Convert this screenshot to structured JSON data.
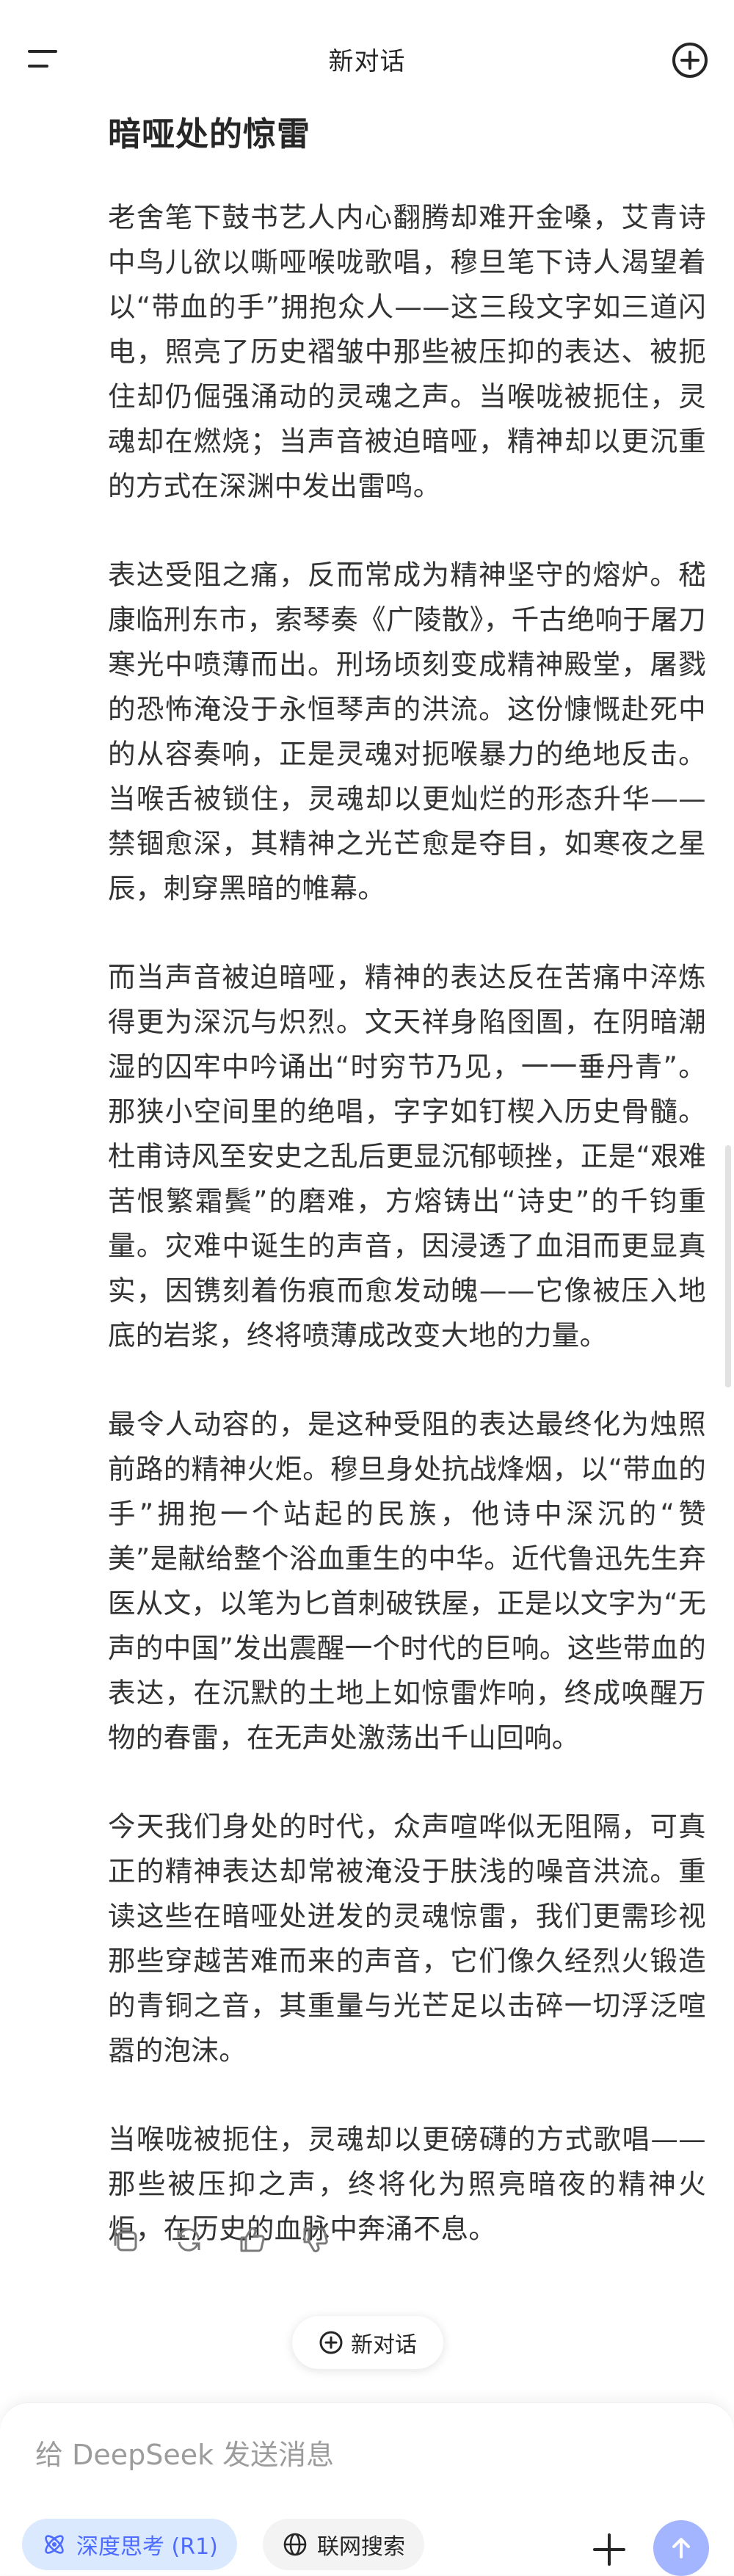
{
  "header": {
    "title": "新对话",
    "menu_icon": "menu-icon",
    "new_chat_icon": "new-chat-plus-icon"
  },
  "article": {
    "title": "暗哑处的惊雷",
    "paragraphs": [
      "老舍笔下鼓书艺人内心翻腾却难开金嗓，艾青诗中鸟儿欲以嘶哑喉咙歌唱，穆旦笔下诗人渴望着以“带血的手”拥抱众人——这三段文字如三道闪电，照亮了历史褶皱中那些被压抑的表达、被扼住却仍倔强涌动的灵魂之声。当喉咙被扼住，灵魂却在燃烧；当声音被迫暗哑，精神却以更沉重的方式在深渊中发出雷鸣。",
      "表达受阻之痛，反而常成为精神坚守的熔炉。嵇康临刑东市，索琴奏《广陵散》，千古绝响于屠刀寒光中喷薄而出。刑场顷刻变成精神殿堂，屠戮的恐怖淹没于永恒琴声的洪流。这份慷慨赴死中的从容奏响，正是灵魂对扼喉暴力的绝地反击。当喉舌被锁住，灵魂却以更灿烂的形态升华——禁锢愈深，其精神之光芒愈是夺目，如寒夜之星辰，刺穿黑暗的帷幕。",
      "而当声音被迫暗哑，精神的表达反在苦痛中淬炼得更为深沉与炽烈。文天祥身陷囹圄，在阴暗潮湿的囚牢中吟诵出“时穷节乃见，一一垂丹青”。那狭小空间里的绝唱，字字如钉楔入历史骨髓。杜甫诗风至安史之乱后更显沉郁顿挫，正是“艰难苦恨繁霜鬓”的磨难，方熔铸出“诗史”的千钧重量。灾难中诞生的声音，因浸透了血泪而更显真实，因镌刻着伤痕而愈发动魄——它像被压入地底的岩浆，终将喷薄成改变大地的力量。",
      "最令人动容的，是这种受阻的表达最终化为烛照前路的精神火炬。穆旦身处抗战烽烟，以“带血的手”拥抱一个站起的民族，他诗中深沉的“赞美”是献给整个浴血重生的中华。近代鲁迅先生弃医从文，以笔为匕首刺破铁屋，正是以文字为“无声的中国”发出震醒一个时代的巨响。这些带血的表达，在沉默的土地上如惊雷炸响，终成唤醒万物的春雷，在无声处激荡出千山回响。",
      "今天我们身处的时代，众声喧哗似无阻隔，可真正的精神表达却常被淹没于肤浅的噪音洪流。重读这些在暗哑处迸发的灵魂惊雷，我们更需珍视那些穿越苦难而来的声音，它们像久经烈火锻造的青铜之音，其重量与光芒足以击碎一切浮泛喧嚣的泡沫。",
      "当喉咙被扼住，灵魂却以更磅礴的方式歌唱——那些被压抑之声，终将化为照亮暗夜的精神火炬，在历史的血脉中奔涌不息。"
    ]
  },
  "message_actions": {
    "icons": [
      "copy-icon",
      "regenerate-icon",
      "thumbs-up-icon",
      "thumbs-down-icon"
    ]
  },
  "new_chat_chip": {
    "label": "新对话"
  },
  "composer": {
    "placeholder": "给 DeepSeek 发送消息",
    "deep_think_label": "深度思考 (R1)",
    "web_search_label": "联网搜索",
    "accent_color": "#4d6bfe",
    "send_color": "#a3b5fe"
  }
}
